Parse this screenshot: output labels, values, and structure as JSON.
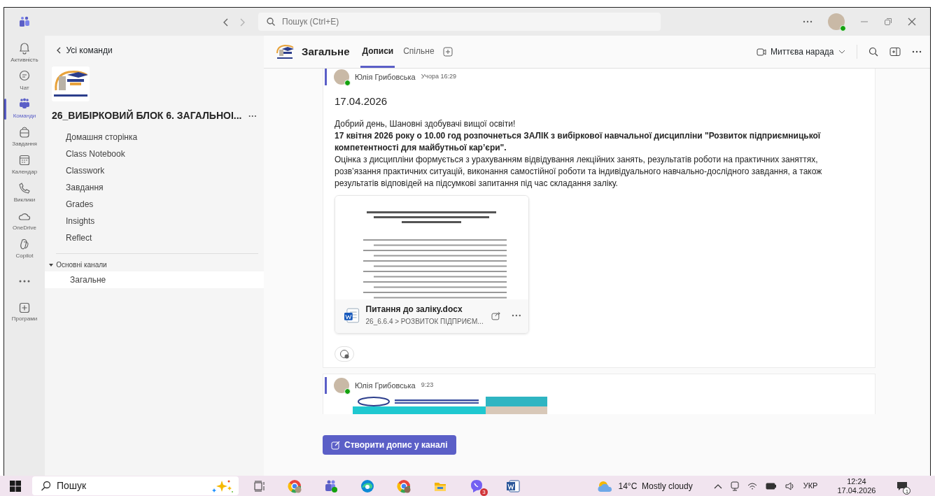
{
  "title_bar": {
    "search_placeholder": "Пошук (Ctrl+E)"
  },
  "app_rail": [
    {
      "label": "Активність",
      "selected": false
    },
    {
      "label": "Чат",
      "selected": false
    },
    {
      "label": "Команди",
      "selected": true
    },
    {
      "label": "Завдання",
      "selected": false
    },
    {
      "label": "Календар",
      "selected": false
    },
    {
      "label": "Виклики",
      "selected": false
    },
    {
      "label": "OneDrive",
      "selected": false
    },
    {
      "label": "Copilot",
      "selected": false
    }
  ],
  "apps_label": "Програми",
  "sidebar": {
    "back_link": "Усі команди",
    "team_name": "26_ВИБІРКОВИЙ БЛОК 6. ЗАГАЛЬНОІ...",
    "items": [
      "Домашня сторінка",
      "Class Notebook",
      "Classwork",
      "Завдання",
      "Grades",
      "Insights",
      "Reflect"
    ],
    "channel_group": {
      "label": "Основні канали",
      "expanded": true,
      "channels": [
        {
          "label": "Загальне",
          "selected": true
        }
      ]
    }
  },
  "channel_header": {
    "name": "Загальне",
    "tabs": [
      {
        "label": "Дописи",
        "selected": true
      },
      {
        "label": "Спільне",
        "selected": false
      }
    ],
    "meet_button": "Миттєва нарада"
  },
  "posts": [
    {
      "author": "Юлія Грибовська",
      "time": "Учора 16:29",
      "title": "17.04.2026",
      "paragraphs": [
        {
          "text": "Добрий день, Шановні здобувачі вищої освіти!",
          "bold": false
        },
        {
          "text": "17 квітня 2026 року о 10.00 год розпочнеться ЗАЛІК з вибіркової навчальної дисципліни \"Розвиток підприємницької компетентності для майбутньої кар’єри\".",
          "bold": true
        },
        {
          "text": "Оцінка з дисципліни формується з урахуванням відвідування лекційних занять, результатів роботи на практичних заняттях, розв’язання практичних ситуацій, виконання самостійної роботи та індивідуального навчально-дослідного завдання, а також результатів відповідей на підсумкові запитання під час складання заліку.",
          "bold": false
        }
      ],
      "attachment": {
        "name": "Питання до заліку.docx",
        "path": "26_6.6.4 > РОЗВИТОК ПІДПРИЄМ..."
      }
    },
    {
      "author": "Юлія Грибовська",
      "time": "9:23"
    }
  ],
  "compose_button": "Створити допис у каналі",
  "taskbar": {
    "search": "Пошук",
    "messenger_badge": "3",
    "weather": "14°C  Mostly cloudy",
    "language": "УКР",
    "time": "12:24",
    "date": "17.04.2026",
    "notification_count": "1"
  }
}
